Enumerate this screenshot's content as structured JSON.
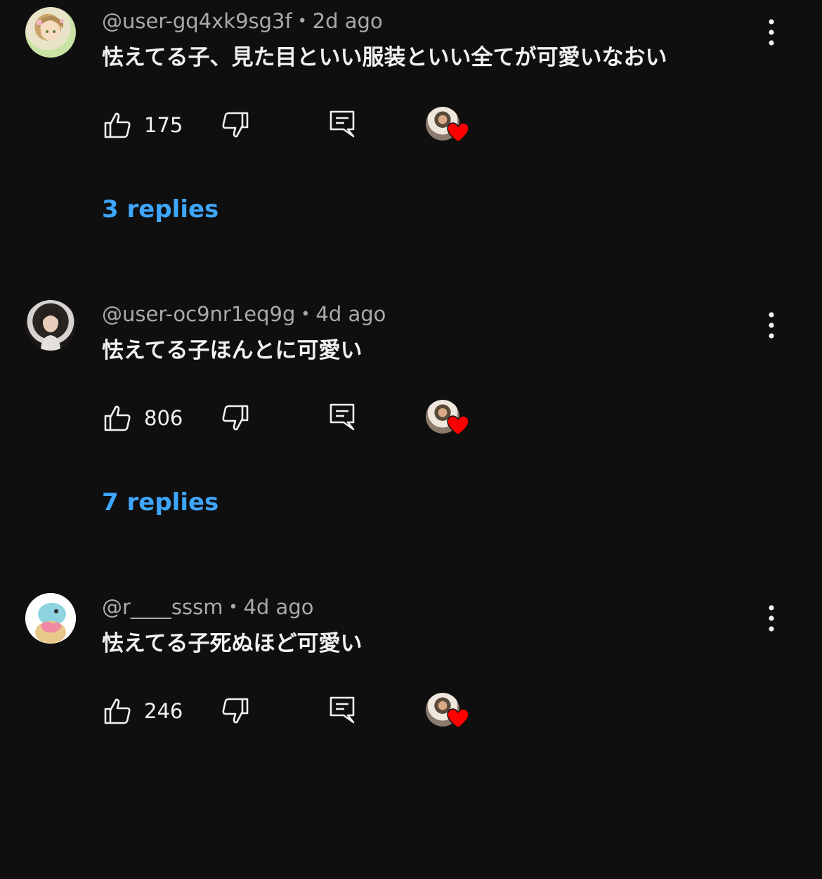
{
  "comments": [
    {
      "username": "@user-gq4xk9sg3f",
      "separator": "•",
      "time": "2d ago",
      "text": "怯えてる子、見た目といい服装といい全てが可愛いなおい",
      "likes": "175",
      "replies_label": "3 replies",
      "avatar_icon": "anime-avatar-icon",
      "creator_heart": true
    },
    {
      "username": "@user-oc9nr1eq9g",
      "separator": "•",
      "time": "4d ago",
      "text": "怯えてる子ほんとに可愛い",
      "likes": "806",
      "replies_label": "7 replies",
      "avatar_icon": "photo-avatar-icon",
      "creator_heart": true
    },
    {
      "username": "@r____sssm",
      "separator": "•",
      "time": "4d ago",
      "text": "怯えてる子死ぬほど可愛い",
      "likes": "246",
      "avatar_icon": "squirtle-avatar-icon",
      "creator_heart": true
    }
  ],
  "colors": {
    "background": "#0f0f0f",
    "primary_text": "#f1f1f1",
    "secondary_text": "#aaaaaa",
    "link": "#3ea6ff",
    "heart": "#ff0000"
  }
}
